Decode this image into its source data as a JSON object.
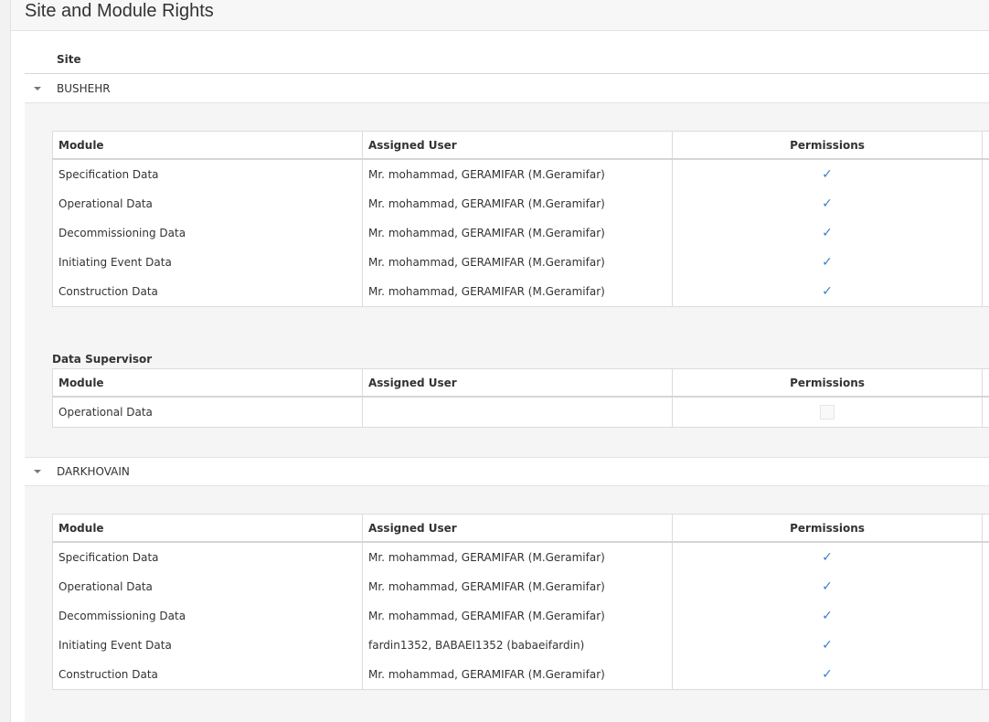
{
  "page": {
    "title": "Site and Module Rights"
  },
  "site_column_header": "Site",
  "table_headers": {
    "module": "Module",
    "assigned_user": "Assigned User",
    "permissions": "Permissions"
  },
  "sites": [
    {
      "name": "BUSHEHR",
      "modules": [
        {
          "module": "Specification Data",
          "user": "Mr. mohammad, GERAMIFAR (M.Geramifar)",
          "permission": true
        },
        {
          "module": "Operational Data",
          "user": "Mr. mohammad, GERAMIFAR (M.Geramifar)",
          "permission": true
        },
        {
          "module": "Decommissioning Data",
          "user": "Mr. mohammad, GERAMIFAR (M.Geramifar)",
          "permission": true
        },
        {
          "module": "Initiating Event Data",
          "user": "Mr. mohammad, GERAMIFAR (M.Geramifar)",
          "permission": true
        },
        {
          "module": "Construction Data",
          "user": "Mr. mohammad, GERAMIFAR (M.Geramifar)",
          "permission": true
        }
      ],
      "supervisor": {
        "label": "Data Supervisor",
        "rows": [
          {
            "module": "Operational Data",
            "user": "",
            "permission": false
          }
        ]
      }
    },
    {
      "name": "DARKHOVAIN",
      "modules": [
        {
          "module": "Specification Data",
          "user": "Mr. mohammad, GERAMIFAR (M.Geramifar)",
          "permission": true
        },
        {
          "module": "Operational Data",
          "user": "Mr. mohammad, GERAMIFAR (M.Geramifar)",
          "permission": true
        },
        {
          "module": "Decommissioning Data",
          "user": "Mr. mohammad, GERAMIFAR (M.Geramifar)",
          "permission": true
        },
        {
          "module": "Initiating Event Data",
          "user": "fardin1352, BABAEI1352 (babaeifardin)",
          "permission": true
        },
        {
          "module": "Construction Data",
          "user": "Mr. mohammad, GERAMIFAR (M.Geramifar)",
          "permission": true
        }
      ]
    }
  ],
  "icons": {
    "expand": "caret-down-icon",
    "checked": "checkmark-icon"
  },
  "colors": {
    "check": "#3b80c8",
    "detail_bg": "#f5f5f5"
  }
}
